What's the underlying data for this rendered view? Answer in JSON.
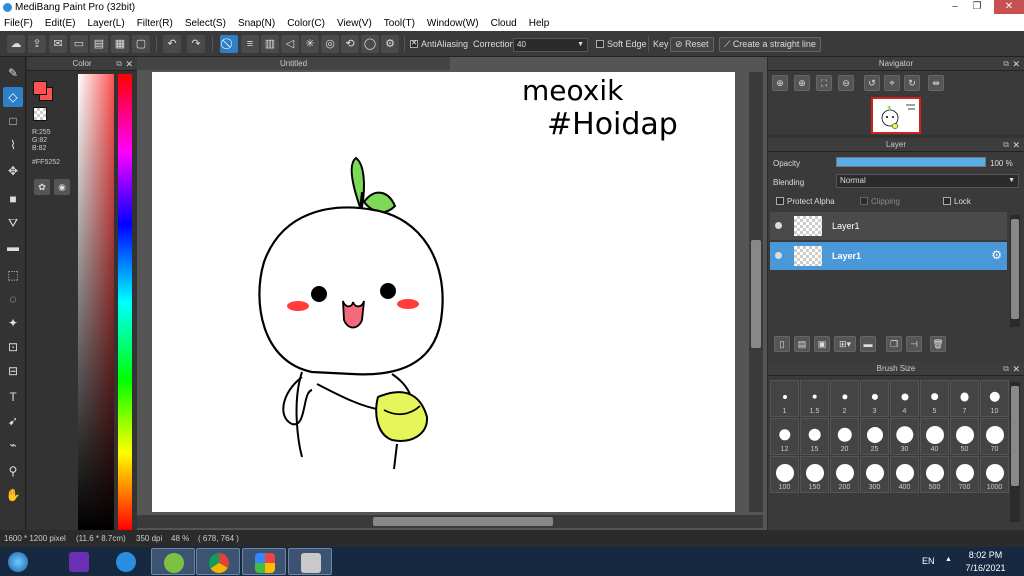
{
  "window": {
    "title": "MediBang Paint Pro (32bit)"
  },
  "menu": [
    "File(F)",
    "Edit(E)",
    "Layer(L)",
    "Filter(R)",
    "Select(S)",
    "Snap(N)",
    "Color(C)",
    "View(V)",
    "Tool(T)",
    "Window(W)",
    "Cloud",
    "Help"
  ],
  "toolbar": {
    "antialiasing_label": "AntiAliasing",
    "correction_label": "Correction",
    "correction_value": "40",
    "soft_edge_label": "Soft Edge",
    "key_label": "Key",
    "reset_label": "Reset",
    "straight_line_label": "Create a straight line"
  },
  "color_panel": {
    "title": "Color",
    "primary_color": "#FF5252",
    "r": "R:255",
    "g": "G:82",
    "b": "B:82",
    "hex": "#FF5252"
  },
  "canvas": {
    "tab_title": "Untitled",
    "handwriting_line1": "meoxik",
    "handwriting_line2": "#Hoidap"
  },
  "navigator": {
    "title": "Navigator"
  },
  "layer_panel": {
    "title": "Layer",
    "opacity_label": "Opacity",
    "opacity_value": "100 %",
    "opacity_fraction": 1.0,
    "blending_label": "Blending",
    "blending_value": "Normal",
    "protect_alpha_label": "Protect Alpha",
    "clipping_label": "Clipping",
    "lock_label": "Lock",
    "layers": [
      {
        "name": "Layer1",
        "selected": false
      },
      {
        "name": "Layer1",
        "selected": true
      }
    ]
  },
  "brush_size": {
    "title": "Brush Size",
    "sizes": [
      "1",
      "1.5",
      "2",
      "3",
      "4",
      "5",
      "7",
      "10",
      "12",
      "15",
      "20",
      "25",
      "30",
      "40",
      "50",
      "70",
      "100",
      "150",
      "200",
      "300",
      "400",
      "500",
      "700",
      "1000"
    ]
  },
  "status": {
    "dimensions": "1600 * 1200 pixel",
    "physical": "(11.6 * 8.7cm)",
    "dpi": "350 dpi",
    "zoom": "48 %",
    "cursor": "( 678, 764 )"
  },
  "taskbar": {
    "language": "EN",
    "time": "8:02 PM",
    "date": "7/16/2021"
  },
  "colors": {
    "accent": "#2d7fc8",
    "selected_layer": "#4a98d8",
    "navigator_frame": "#d12020",
    "leaf_green": "#7ed957",
    "bag_yellow": "#e6f55a",
    "blush": "#ff3b3b"
  }
}
